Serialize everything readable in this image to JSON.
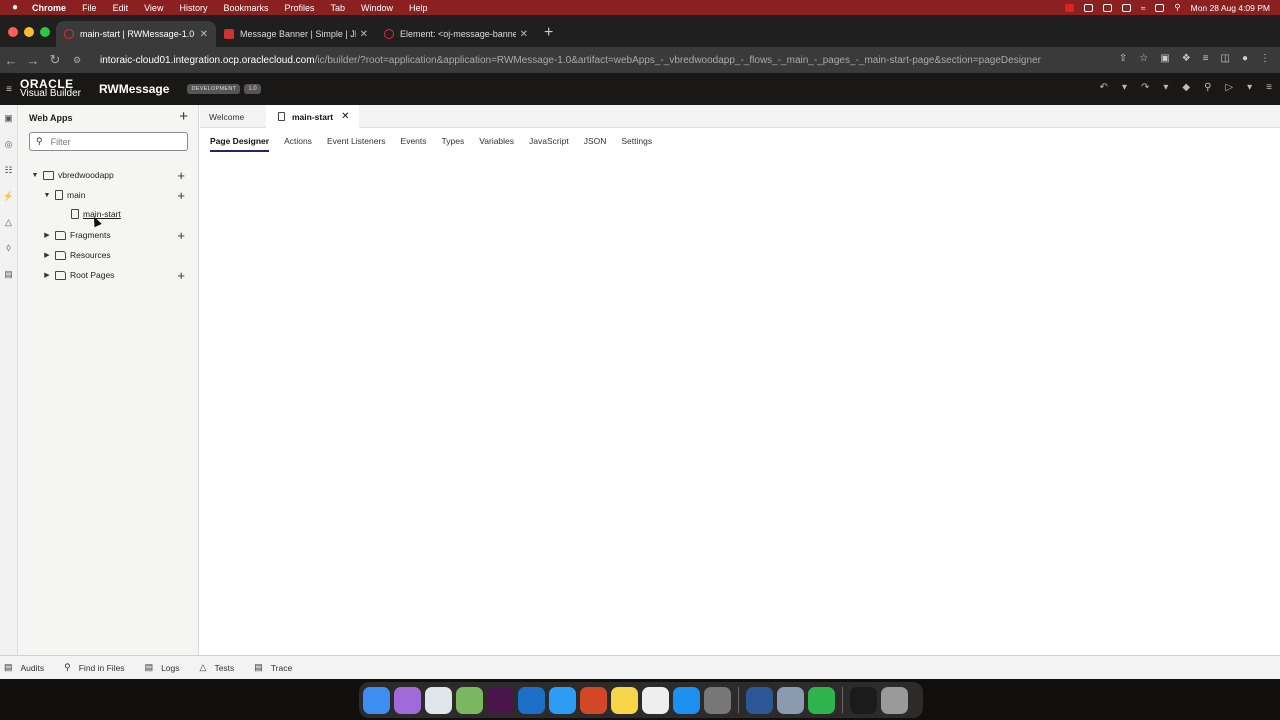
{
  "menubar": {
    "apple": "",
    "items": [
      "Chrome",
      "File",
      "Edit",
      "View",
      "History",
      "Bookmarks",
      "Profiles",
      "Tab",
      "Window",
      "Help"
    ],
    "datetime": "Mon 28 Aug  4:09 PM"
  },
  "browser": {
    "tabs": [
      {
        "title": "main-start | RWMessage-1.0 |"
      },
      {
        "title": "Message Banner | Simple | JET"
      },
      {
        "title": "Element: <oj-message-banner"
      }
    ],
    "url_host": "intoraic-cloud01.integration.ocp.oraclecloud.com",
    "url_path": "/ic/builder/?root=application&application=RWMessage-1.0&artifact=webApps_-_vbredwoodapp_-_flows_-_main_-_pages_-_main-start-page&section=pageDesigner"
  },
  "vb": {
    "logo_line1": "ORACLE",
    "logo_line2": "Visual Builder",
    "app_name": "RWMessage",
    "env_badge": "DEVELOPMENT",
    "version": "1.0"
  },
  "navigator": {
    "title": "Web Apps",
    "filter_placeholder": "Filter",
    "tree": {
      "app": "vbredwoodapp",
      "flow": "main",
      "page": "main-start",
      "fragments": "Fragments",
      "resources": "Resources",
      "root_pages": "Root Pages"
    }
  },
  "editor": {
    "tabs": {
      "welcome": "Welcome",
      "active": "main-start"
    },
    "subtabs": [
      "Page Designer",
      "Actions",
      "Event Listeners",
      "Events",
      "Types",
      "Variables",
      "JavaScript",
      "JSON",
      "Settings"
    ]
  },
  "bottom": {
    "items": [
      "Audits",
      "Find in Files",
      "Logs",
      "Tests",
      "Trace"
    ]
  },
  "colors": {
    "menubar": "#8a2020",
    "vb_header": "#1a1816",
    "accent": "#222277"
  }
}
